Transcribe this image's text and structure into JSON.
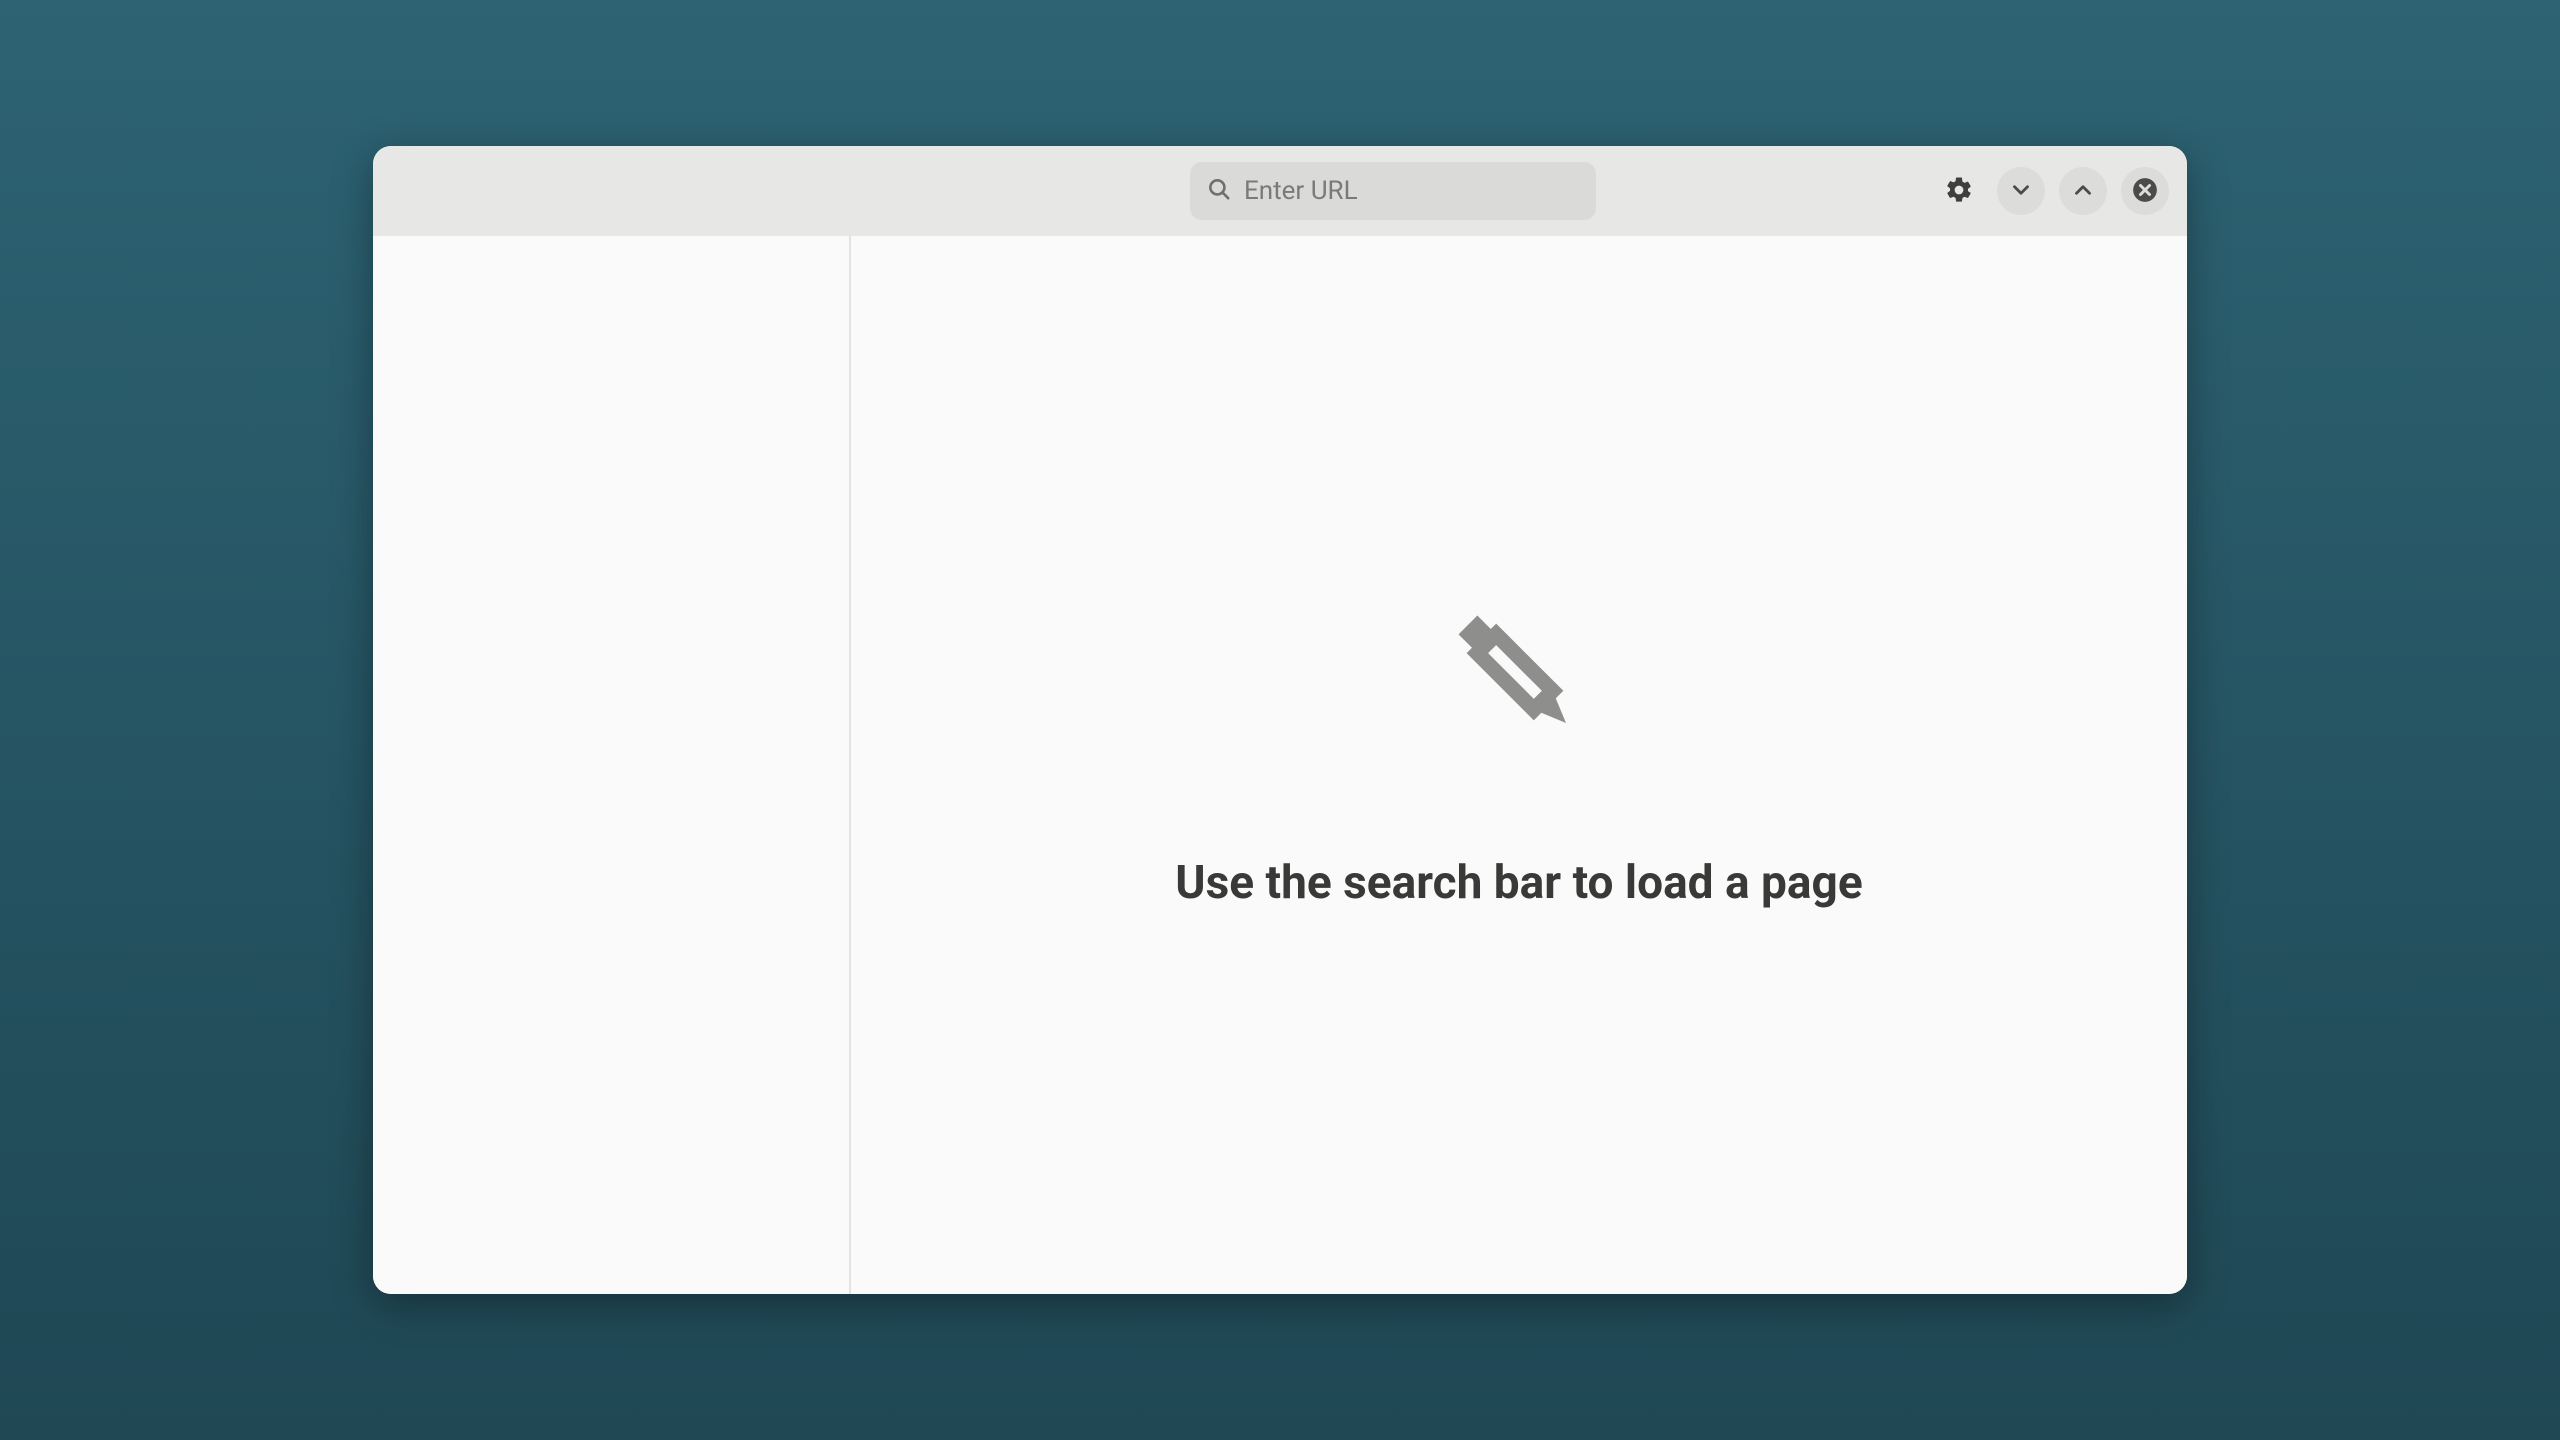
{
  "titlebar": {
    "search_placeholder": "Enter URL",
    "search_value": ""
  },
  "content": {
    "hint": "Use the search bar to load a page"
  },
  "icons": {
    "search": "search-icon",
    "settings": "gear-icon",
    "down": "chevron-down-icon",
    "up": "chevron-up-icon",
    "close": "close-circle-icon",
    "pencil": "pencil-icon"
  },
  "colors": {
    "window_bg": "#fafafa",
    "titlebar_bg": "#e7e7e6",
    "input_bg": "#dadad8",
    "button_bg": "#dcdcda",
    "icon_gray": "#4b4b4a",
    "text_dark": "#393937",
    "bg_gradient_top": "#2d6373",
    "bg_gradient_bottom": "#1f4754"
  }
}
